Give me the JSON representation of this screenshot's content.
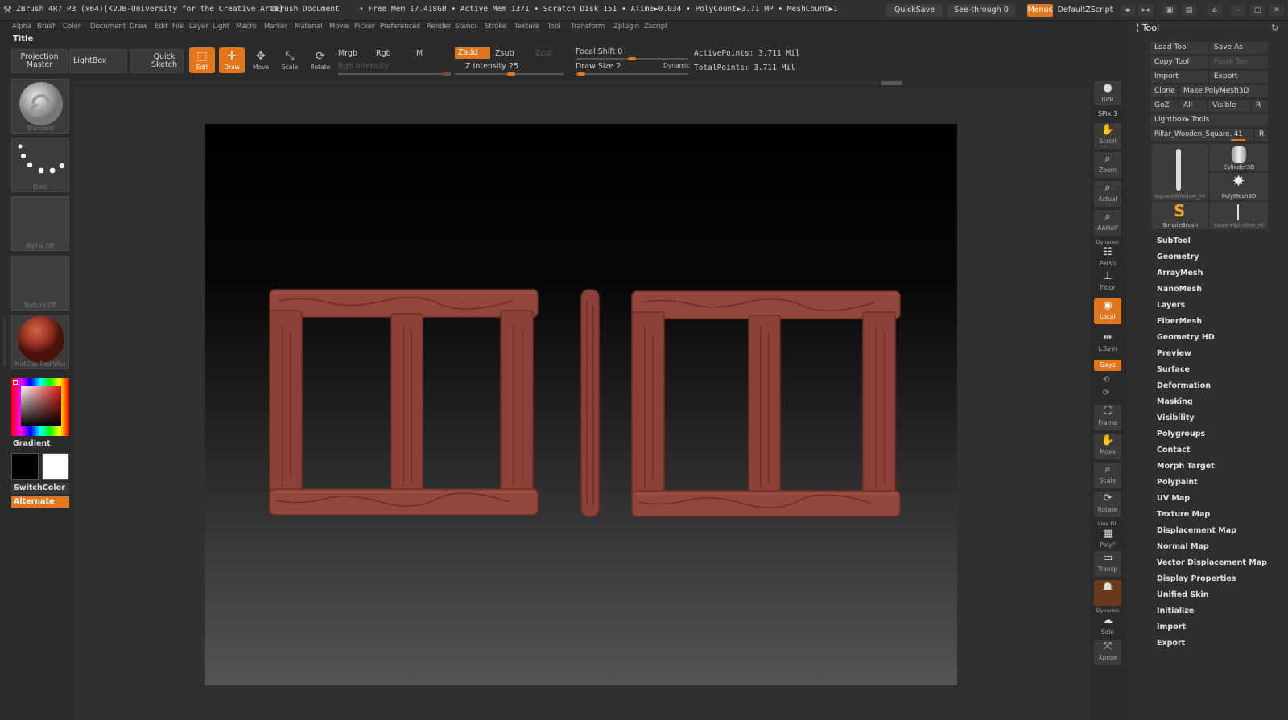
{
  "titlebar": {
    "app_title": "ZBrush 4R7 P3 (x64)[KVJB-University for the Creative Arts]",
    "document": "ZBrush Document",
    "stats": "• Free Mem 17.418GB • Active Mem 1371 • Scratch Disk 151 • ATime▶0.034 • PolyCount▶3.71 MP • MeshCount▶1",
    "quicksave": "QuickSave",
    "seethrough": "See-through",
    "seethrough_value": "0",
    "menus": "Menus",
    "script": "DefaultZScript"
  },
  "menubar": [
    "Alpha",
    "Brush",
    "Color",
    "Document",
    "Draw",
    "Edit",
    "File",
    "Layer",
    "Light",
    "Macro",
    "Marker",
    "Material",
    "Movie",
    "Picker",
    "Preferences",
    "Render",
    "Stencil",
    "Stroke",
    "Texture",
    "Tool",
    "Transform",
    "Zplugin",
    "Zscript"
  ],
  "shelf": {
    "title": "Title",
    "projection_master": "Projection Master",
    "lightbox": "LightBox",
    "quick_sketch": "Quick Sketch",
    "edit": "Edit",
    "draw": "Draw",
    "move": "Move",
    "scale": "Scale",
    "rotate": "Rotate",
    "mrgb": "Mrgb",
    "rgb": "Rgb",
    "m": "M",
    "rgb_intensity": "Rgb Intensity",
    "zadd": "Zadd",
    "zsub": "Zsub",
    "zcut": "Zcut",
    "z_intensity": "Z Intensity 25",
    "focal_shift": "Focal Shift 0",
    "draw_size": "Draw Size 2",
    "dynamic": "Dynamic",
    "active_points": "ActivePoints: 3.711 Mil",
    "total_points": "TotalPoints: 3.711 Mil"
  },
  "left": {
    "brush": "Standard",
    "stroke": "Dots",
    "alpha": "Alpha Off",
    "texture": "Texture Off",
    "material": "MatCap Red Wax",
    "gradient": "Gradient",
    "switchcolor": "SwitchColor",
    "alternate": "Alternate"
  },
  "rightshelf": {
    "bpr": "BPR",
    "spix": "SPix 3",
    "scroll": "Scroll",
    "zoom": "Zoom",
    "actual": "Actual",
    "aahalf": "AAHalf",
    "dynamic": "Dynamic",
    "persp": "Persp",
    "floor": "Floor",
    "local": "Local",
    "lsym": "L.Sym",
    "xyz": "Gxyz",
    "frame": "Frame",
    "move": "Move",
    "scale": "Scale",
    "rotate": "Rotate",
    "linefill": "Line Fill",
    "polyf": "PolyF",
    "transp": "Transp",
    "dynamic2": "Dynamic",
    "solo": "Solo",
    "xpose": "Xpose"
  },
  "tool": {
    "title": "Tool",
    "load": "Load Tool",
    "save_as": "Save As",
    "copy": "Copy Tool",
    "paste": "Paste Tool",
    "import": "Import",
    "export": "Export",
    "clone": "Clone",
    "make_polymesh": "Make PolyMesh3D",
    "goz": "GoZ",
    "all": "All",
    "visible": "Visible",
    "r": "R",
    "lightbox_tools": "Lightbox▸ Tools",
    "current_tool": "Pillar_Wooden_Square. 41",
    "thumbs": [
      "squareWindow_Hi",
      "Cylinder3D",
      "PolyMesh3D",
      "SimpleBrush",
      "squareWindow_Hi"
    ],
    "sections": [
      "SubTool",
      "Geometry",
      "ArrayMesh",
      "NanoMesh",
      "Layers",
      "FiberMesh",
      "Geometry HD",
      "Preview",
      "Surface",
      "Deformation",
      "Masking",
      "Visibility",
      "Polygroups",
      "Contact",
      "Morph Target",
      "Polypaint",
      "UV Map",
      "Texture Map",
      "Displacement Map",
      "Normal Map",
      "Vector Displacement Map",
      "Display Properties",
      "Unified Skin",
      "Initialize",
      "Import",
      "Export"
    ]
  },
  "colors": {
    "accent": "#e2761d",
    "wood": "#8c4038"
  }
}
